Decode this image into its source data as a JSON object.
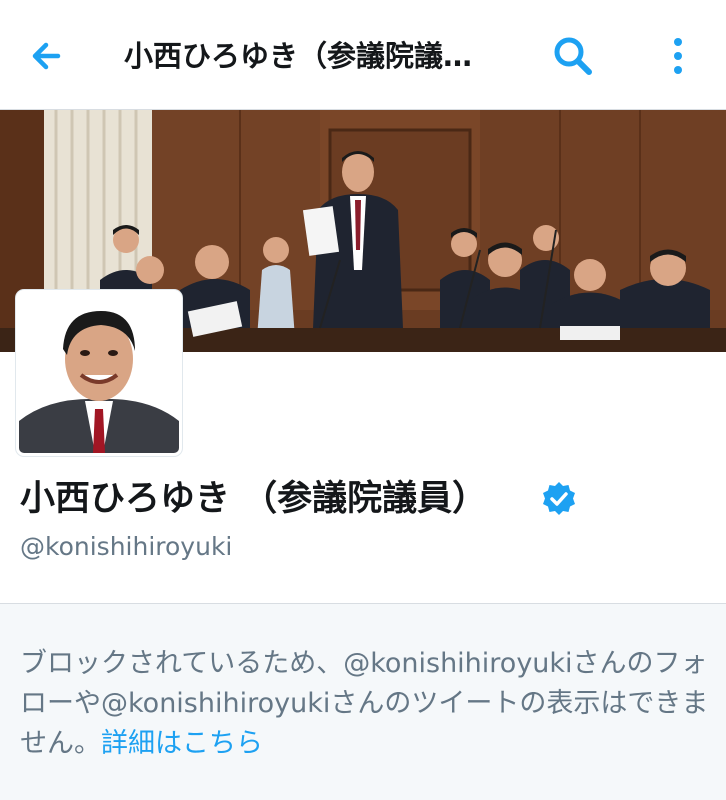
{
  "header": {
    "title": "小西ひろゆき（参議院議…",
    "back_icon": "back-arrow-icon",
    "search_icon": "search-icon",
    "more_icon": "more-vertical-icon",
    "accent_color": "#1da1f2"
  },
  "profile": {
    "name": "小西ひろゆき （参議院議員）",
    "handle": "@konishihiroyuki",
    "verified": true,
    "verified_icon": "verified-badge-icon"
  },
  "blocked_notice": {
    "text": "ブロックされているため、@konishihiroyukiさんのフォローや@konishihiroyukiさんのツイートの表示はできません。",
    "link_text": "詳細はこちら"
  }
}
